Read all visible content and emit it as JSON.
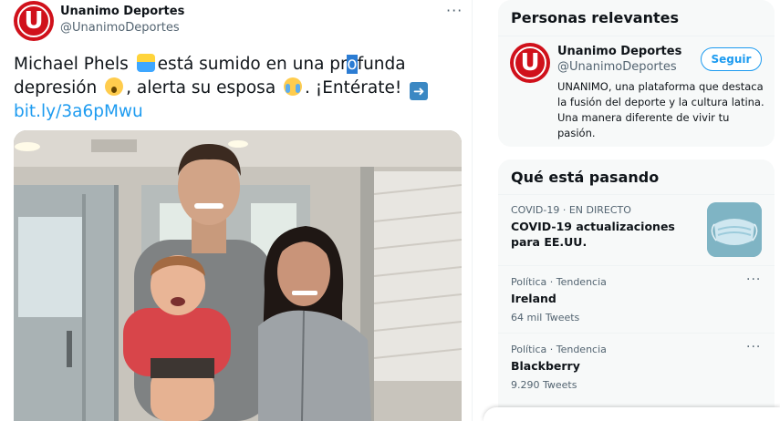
{
  "tweet": {
    "author_name": "Unanimo Deportes",
    "author_handle": "@UnanimoDeportes",
    "avatar_letter": "U",
    "more_label": "···",
    "text_1": "Michael Phels ",
    "text_2": "está sumido en una pr",
    "text_cursor": "o",
    "text_3": "funda depresión ",
    "text_4": ", alerta su esposa ",
    "text_5": ". ¡Entérate! ",
    "link": "bit.ly/3a6pMwu",
    "emojis": [
      "swimmer-emoji",
      "scream-emoji",
      "crying-emoji",
      "right-arrow-emoji"
    ]
  },
  "relevant": {
    "title": "Personas relevantes",
    "name": "Unanimo Deportes",
    "handle": "@UnanimoDeportes",
    "avatar_letter": "U",
    "follow_label": "Seguir",
    "bio": "UNANIMO, una plataforma que destaca la fusión del deporte y la cultura latina. Una manera diferente de vivir tu pasión."
  },
  "trends": {
    "title": "Qué está pasando",
    "items": [
      {
        "meta": "COVID-19 · EN DIRECTO",
        "title": "COVID-19 actualizaciones para EE.UU.",
        "count": ""
      },
      {
        "meta": "Política · Tendencia",
        "title": "Ireland",
        "count": "64 mil Tweets",
        "more": "···"
      },
      {
        "meta": "Política · Tendencia",
        "title": "Blackberry",
        "count": "9.290 Tweets",
        "more": "···"
      }
    ]
  },
  "colors": {
    "accent": "#1d9bf0",
    "brand_red": "#d0111b",
    "card_bg": "#f7f9f9",
    "secondary_text": "#536471"
  }
}
